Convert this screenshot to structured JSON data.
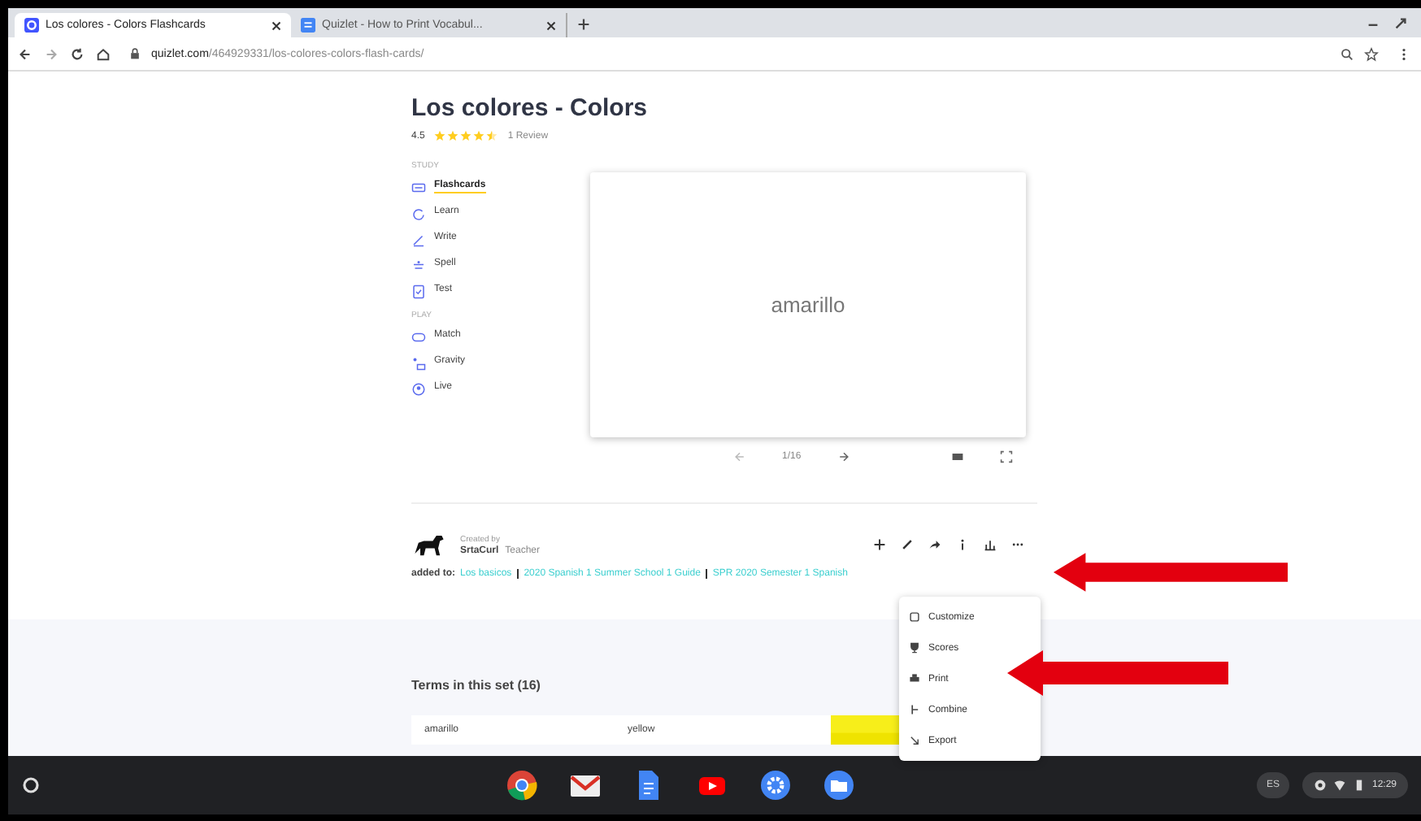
{
  "browser": {
    "tabs": [
      {
        "title": "Los colores - Colors Flashcards",
        "selected": true,
        "kind": "quizlet"
      },
      {
        "title": "Quizlet - How to Print Vocabul...",
        "selected": false,
        "kind": "docs"
      }
    ],
    "url": {
      "host": "quizlet.com",
      "path": "/464929331/los-colores-colors-flash-cards/"
    }
  },
  "set": {
    "title": "Los colores - Colors",
    "rating": "4.5",
    "stars": 4.5,
    "reviews": "1 Review"
  },
  "study_modes": [
    {
      "heading": "STUDY",
      "items": [
        {
          "label": "Flashcards",
          "selected": true,
          "kind": "cards"
        },
        {
          "label": "Learn",
          "selected": false,
          "kind": "learn"
        },
        {
          "label": "Write",
          "selected": false,
          "kind": "write"
        },
        {
          "label": "Spell",
          "selected": false,
          "kind": "spell"
        },
        {
          "label": "Test",
          "selected": false,
          "kind": "test"
        }
      ]
    },
    {
      "heading": "PLAY",
      "items": [
        {
          "label": "Match",
          "selected": false,
          "kind": "match"
        },
        {
          "label": "Gravity",
          "selected": false,
          "kind": "gravity"
        },
        {
          "label": "Live",
          "selected": false,
          "kind": "live"
        }
      ]
    }
  ],
  "card": {
    "term": "amarillo",
    "progress": "1/16"
  },
  "creator": {
    "caption": "Created by",
    "name": "SrtaCurl",
    "role": "Teacher"
  },
  "added_to": {
    "label": "added to:",
    "sets": [
      "Los basicos",
      "2020 Spanish 1 Summer School 1 Guide",
      "SPR 2020 Semester 1 Spanish"
    ]
  },
  "more_menu": {
    "items": [
      {
        "label": "Customize",
        "kind": "customize"
      },
      {
        "label": "Scores",
        "kind": "scores"
      },
      {
        "label": "Print",
        "kind": "print"
      },
      {
        "label": "Combine",
        "kind": "combine"
      },
      {
        "label": "Export",
        "kind": "export"
      }
    ]
  },
  "terms": {
    "heading": "Terms in this set (16)",
    "rows": [
      {
        "term": "amarillo",
        "definition": "yellow"
      }
    ]
  },
  "taskbar": {
    "input_method": "ES",
    "time": "12:29"
  }
}
